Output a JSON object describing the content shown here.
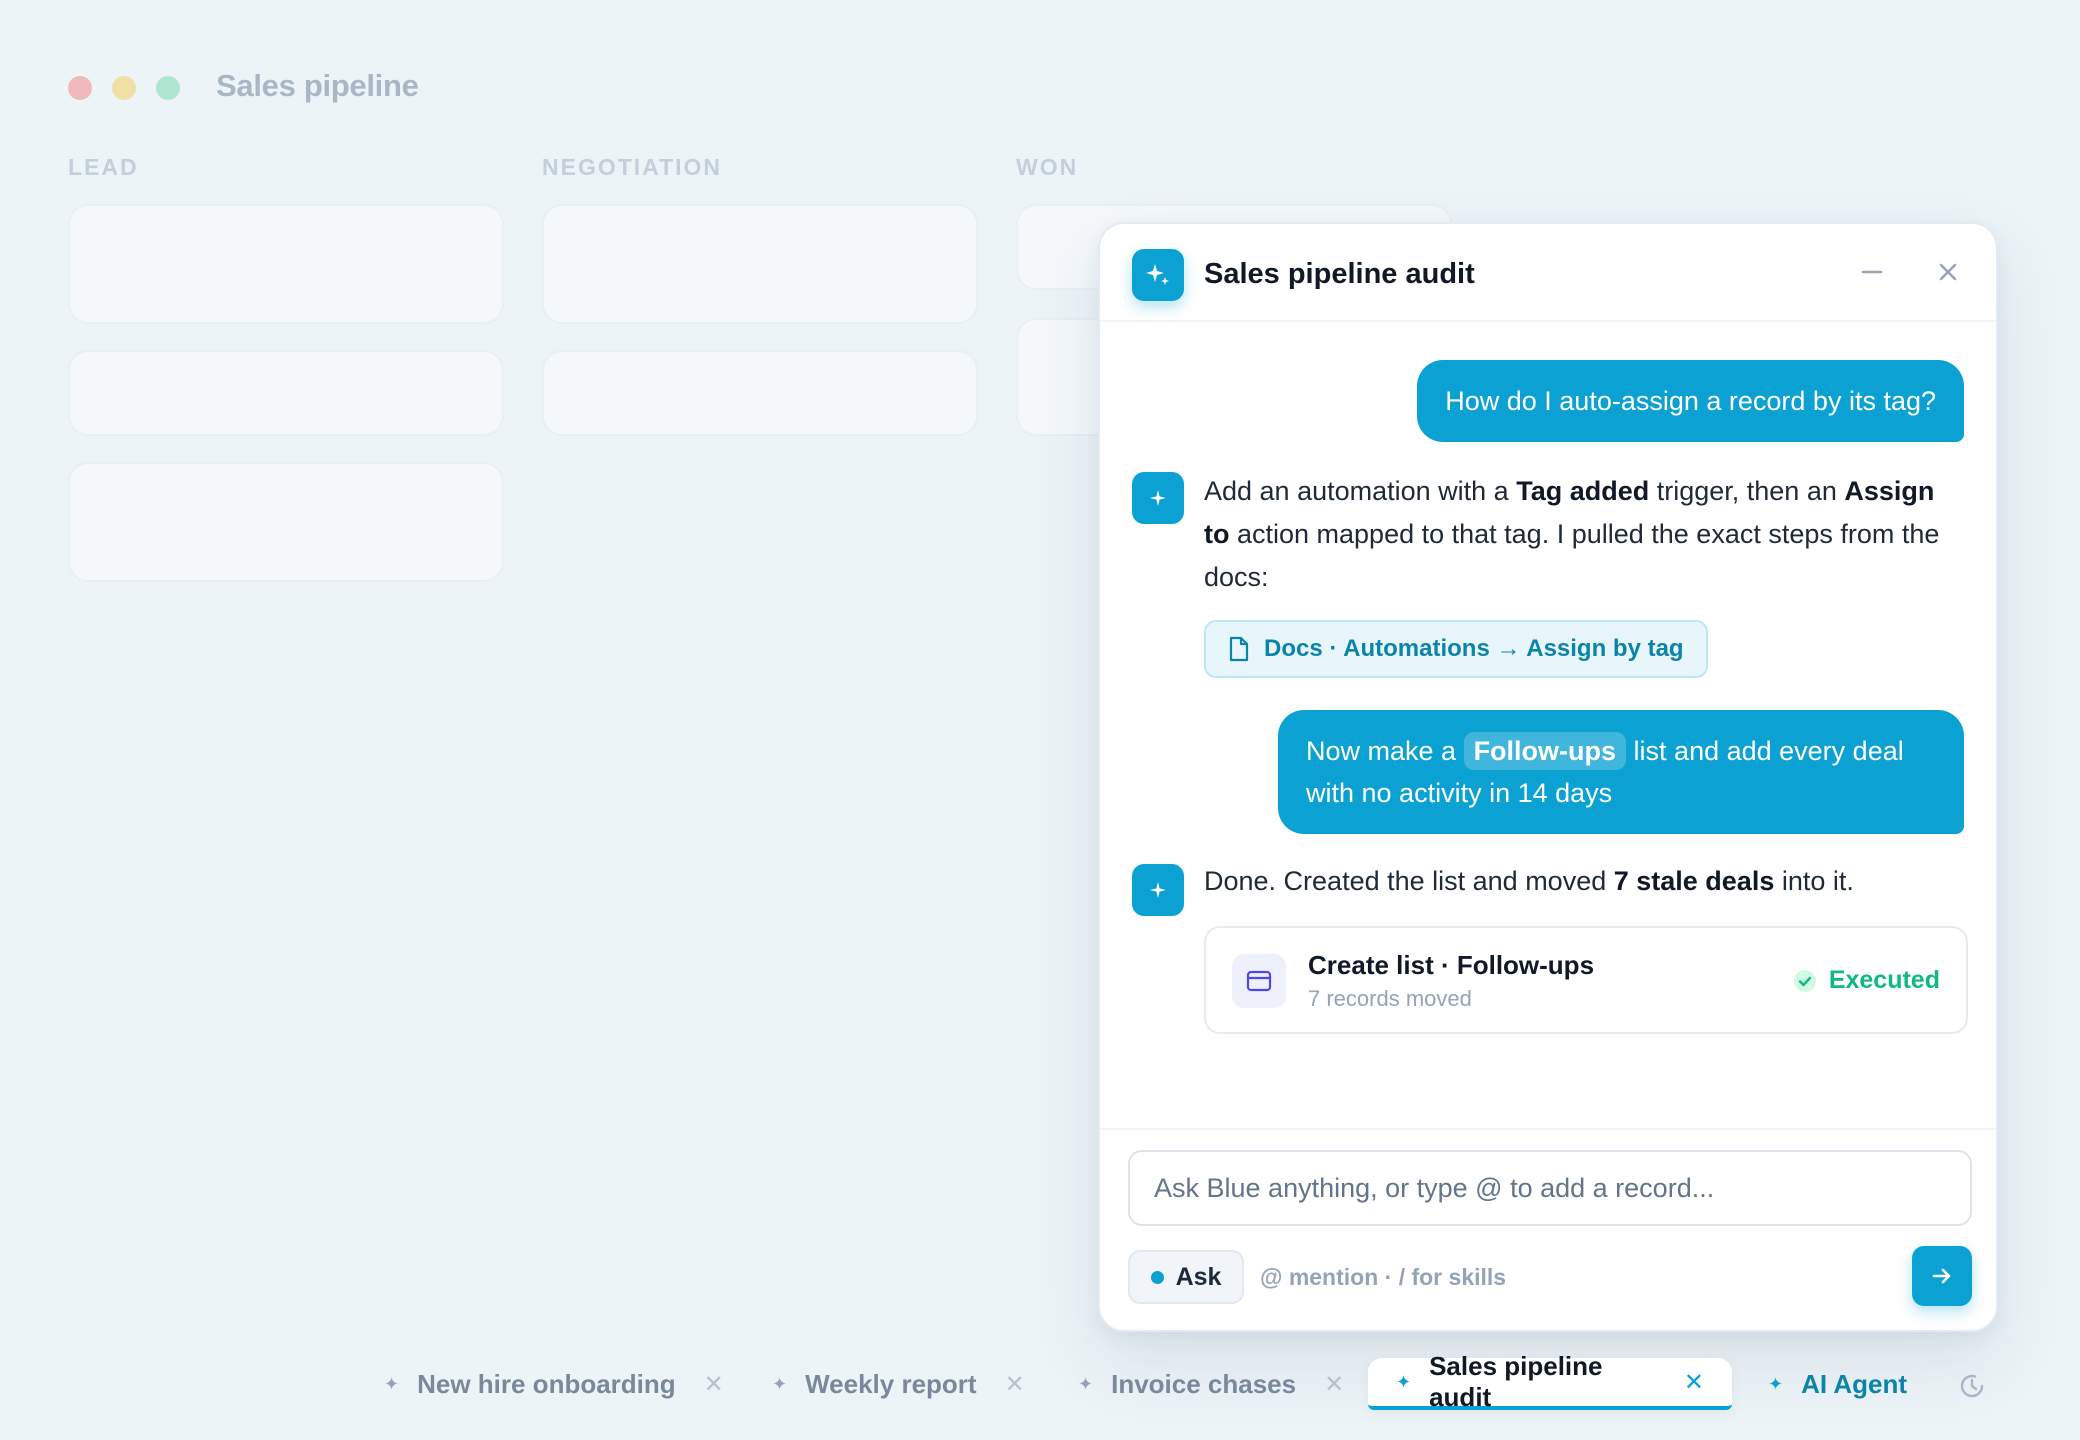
{
  "background": {
    "title": "Sales pipeline",
    "columns": [
      "LEAD",
      "NEGOTIATION",
      "WON"
    ]
  },
  "panel": {
    "title": "Sales pipeline audit",
    "messages": {
      "user1": "How do I auto-assign a record by its tag?",
      "bot1": {
        "t1": "Add an automation with a ",
        "b1": "Tag added",
        "t2": " trigger, then an ",
        "b2": "Assign to",
        "t3": " action mapped to that tag. I pulled the exact steps from the docs:"
      },
      "doc_link": "Docs · Automations → Assign by tag",
      "user2": {
        "t1": "Now make a ",
        "chip": "Follow-ups",
        "t2": " list and add every deal with no activity in 14 days"
      },
      "bot2": {
        "t1": "Done. Created the list and moved ",
        "b1": "7 stale deals",
        "t2": " into it."
      }
    },
    "action_card": {
      "title": "Create list · Follow-ups",
      "subtitle": "7 records moved",
      "status": "Executed"
    },
    "composer": {
      "placeholder": "Ask Blue anything, or type @ to add a record...",
      "mode": "Ask",
      "hint": "@ mention · / for skills"
    }
  },
  "tabs": [
    {
      "label": "New hire onboarding"
    },
    {
      "label": "Weekly report"
    },
    {
      "label": "Invoice chases"
    },
    {
      "label": "Sales pipeline audit",
      "active": true
    }
  ],
  "agent_tab": "AI Agent",
  "colors": {
    "accent": "#0ba2d3",
    "success": "#10b981",
    "background": "#edf4f8"
  },
  "icons": [
    "sparkle-icon",
    "minimize-icon",
    "close-icon",
    "document-icon",
    "list-icon",
    "check-circle-icon",
    "arrow-right-icon",
    "history-icon"
  ]
}
